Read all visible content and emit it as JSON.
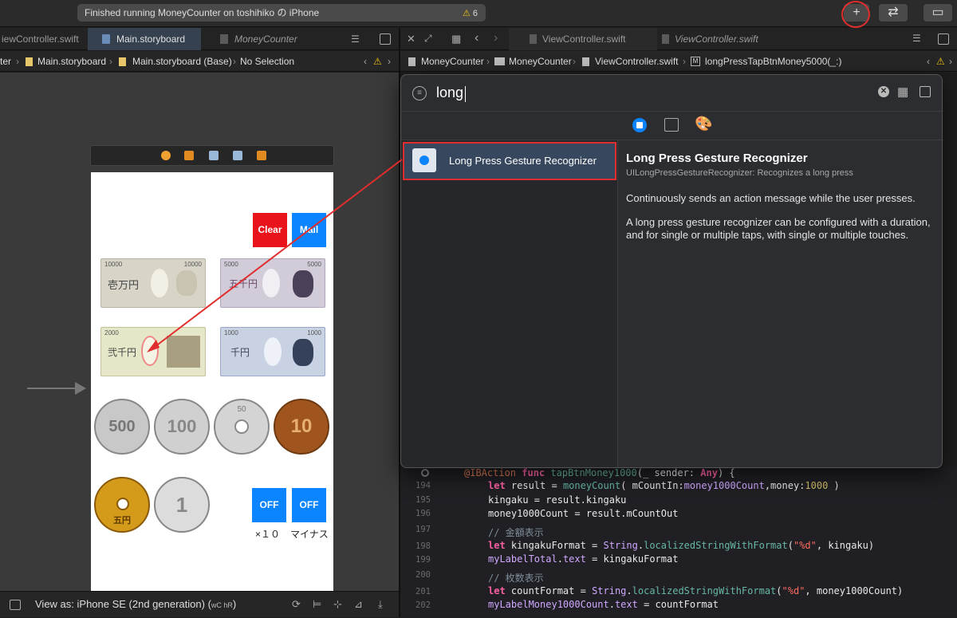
{
  "toolbar": {
    "status_text": "Finished running MoneyCounter on toshihiko の iPhone",
    "warning_count": "6",
    "add_label": "+",
    "swap_label": "⇄",
    "inspector_label": "▭"
  },
  "left_tabs": {
    "tab1": "iewController.swift",
    "tab2": "Main.storyboard",
    "tab3": "MoneyCounter"
  },
  "left_breadcrumb": {
    "c0": "ter",
    "c1": "Main.storyboard",
    "c2": "Main.storyboard (Base)",
    "c3": "No Selection"
  },
  "phone": {
    "clear_label": "Clear",
    "mail_label": "Mail",
    "off1_label": "OFF",
    "off2_label": "OFF",
    "x10_label": "×１０",
    "minus_label": "マイナス",
    "bill_10000": "10000",
    "bill_10000_kanji": "壱万円",
    "bill_5000": "5000",
    "bill_5000_kanji": "五千円",
    "bill_2000": "2000",
    "bill_2000_kanji": "弐千円",
    "bill_1000": "1000",
    "bill_1000_kanji": "千円",
    "coin_500": "500",
    "coin_100": "100",
    "coin_50": "50",
    "coin_10": "10",
    "coin_5": "五円",
    "coin_1": "1"
  },
  "bottom_bar": {
    "view_as": "View as: iPhone SE (2nd generation) (",
    "view_as_mid": "wC hR",
    "view_as_end": ")"
  },
  "right_tabs": {
    "tab1": "ViewController.swift",
    "tab2": "ViewController.swift"
  },
  "right_breadcrumb": {
    "c1": "MoneyCounter",
    "c2": "MoneyCounter",
    "c3": "ViewController.swift",
    "c4": "longPressTapBtnMoney5000(_:)"
  },
  "library": {
    "search_value": "long",
    "item_label": "Long Press Gesture Recognizer",
    "detail_title": "Long Press Gesture Recognizer",
    "detail_subtitle": "UILongPressGestureRecognizer: Recognizes a long press",
    "detail_p1": "Continuously sends an action message while the user presses.",
    "detail_p2": "A long press gesture recognizer can be configured with a duration, and for single or multiple taps, with single or multiple touches."
  },
  "code": {
    "l193_a": "@IBAction",
    "l193_b": " func ",
    "l193_c": "tapBtnMoney1000",
    "l193_d": "(_ sender: ",
    "l193_e": "Any",
    "l193_f": ") {",
    "n194": "194",
    "n195": "195",
    "n196": "196",
    "n197": "197",
    "n198": "198",
    "n199": "199",
    "n200": "200",
    "n201": "201",
    "n202": "202",
    "l194_a": "let",
    "l194_b": " result = ",
    "l194_c": "moneyCount",
    "l194_d": "( mCountIn:",
    "l194_e": "money1000Count",
    "l194_f": ",money:",
    "l194_g": "1000",
    "l194_h": " )",
    "l195": "kingaku = result.kingaku",
    "l196": "money1000Count = result.mCountOut",
    "l197": "// 金額表示",
    "l198_a": "let",
    "l198_b": " kingakuFormat = ",
    "l198_c": "String",
    "l198_d": ".",
    "l198_e": "localizedStringWithFormat",
    "l198_f": "(",
    "l198_g": "\"%d\"",
    "l198_h": ", kingaku)",
    "l199_a": "myLabelTotal",
    "l199_b": ".",
    "l199_c": "text",
    "l199_d": " = kingakuFormat",
    "l200": "// 枚数表示",
    "l201_a": "let",
    "l201_b": " countFormat = ",
    "l201_c": "String",
    "l201_d": ".",
    "l201_e": "localizedStringWithFormat",
    "l201_f": "(",
    "l201_g": "\"%d\"",
    "l201_h": ", money1000Count)",
    "l202_a": "myLabelMoney1000Count",
    "l202_b": ".",
    "l202_c": "text",
    "l202_d": " = countFormat"
  }
}
